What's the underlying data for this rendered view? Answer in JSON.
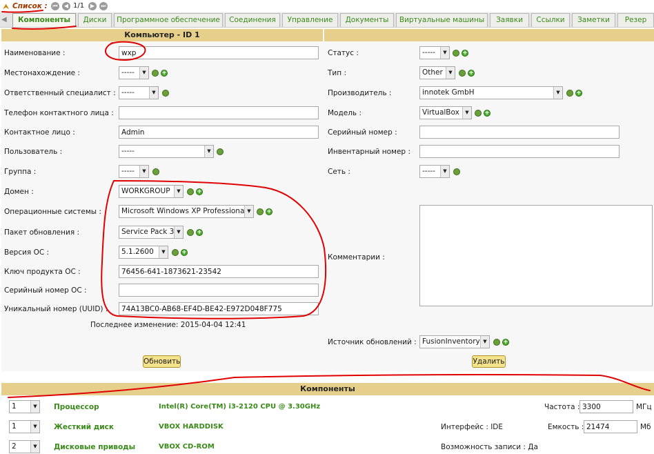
{
  "listbar": {
    "label": "Список :",
    "pager": "1/1"
  },
  "tabs": [
    "Компоненты",
    "Диски",
    "Программное обеспечение",
    "Соединения",
    "Управление",
    "Документы",
    "Виртуальные машины",
    "Заявки",
    "Ссылки",
    "Заметки",
    "Резер"
  ],
  "header": {
    "title": "Компьютер - ID 1"
  },
  "left": {
    "name_label": "Наименование :",
    "name_value": "wxp",
    "location_label": "Местонахождение :",
    "location_value": "-----",
    "tech_label": "Ответственный специалист :",
    "tech_value": "-----",
    "phone_label": "Телефон контактного лица :",
    "phone_value": "",
    "contact_label": "Контактное лицо :",
    "contact_value": "Admin",
    "user_label": "Пользователь :",
    "user_value": "-----",
    "group_label": "Группа :",
    "group_value": "-----",
    "domain_label": "Домен :",
    "domain_value": "WORKGROUP",
    "os_label": "Операционные системы :",
    "os_value": "Microsoft Windows XP Professional",
    "sp_label": "Пакет обновления :",
    "sp_value": "Service Pack 3",
    "osver_label": "Версия ОС :",
    "osver_value": "5.1.2600",
    "key_label": "Ключ продукта ОС :",
    "key_value": "76456-641-1873621-23542",
    "serial_label": "Серийный номер ОС :",
    "serial_value": "",
    "uuid_label": "Уникальный номер (UUID) :",
    "uuid_value": "74A13BC0-AB68-EF4D-BE42-E972D048F775",
    "last_change": "Последнее изменение: 2015-04-04 12:41",
    "update_button": "Обновить"
  },
  "right": {
    "status_label": "Статус :",
    "status_value": "-----",
    "type_label": "Тип :",
    "type_value": "Other",
    "manufacturer_label": "Производитель :",
    "manufacturer_value": "innotek GmbH",
    "model_label": "Модель :",
    "model_value": "VirtualBox",
    "serial_label": "Серийный номер :",
    "serial_value": "",
    "inventory_label": "Инвентарный номер :",
    "inventory_value": "",
    "network_label": "Сеть :",
    "network_value": "-----",
    "comments_label": "Комментарии :",
    "source_label": "Источник обновлений :",
    "source_value": "FusionInventory",
    "delete_button": "Удалить"
  },
  "components": {
    "title": "Компоненты",
    "rows": [
      {
        "qty": "1",
        "name": "Процессор",
        "value": "Intel(R) Core(TM) i3-2120 CPU @ 3.30GHz",
        "mid": "",
        "prop_label": "Частота :",
        "prop_value": "3300",
        "unit": "МГц"
      },
      {
        "qty": "1",
        "name": "Жесткий диск",
        "value": "VBOX HARDDISK",
        "mid": "Интерфейс : IDE",
        "prop_label": "Емкость :",
        "prop_value": "21474",
        "unit": "Мб"
      },
      {
        "qty": "2",
        "name": "Дисковые приводы",
        "value": "VBOX CD-ROM",
        "mid": "Возможность записи : Да",
        "prop_label": "",
        "prop_value": "",
        "unit": ""
      }
    ]
  },
  "colors": {
    "header_bg": "#e6cf8a",
    "link_green": "#3a8a1a",
    "annotation_red": "#e00000"
  }
}
